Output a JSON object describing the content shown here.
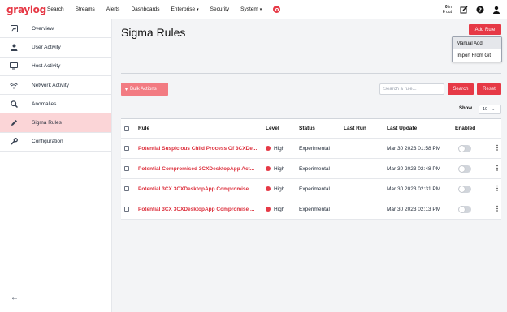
{
  "app": {
    "logo": "graylog"
  },
  "topnav": {
    "items": [
      {
        "label": "Search"
      },
      {
        "label": "Streams"
      },
      {
        "label": "Alerts"
      },
      {
        "label": "Dashboards"
      },
      {
        "label": "Enterprise",
        "caret": "▾"
      },
      {
        "label": "Security"
      },
      {
        "label": "System",
        "caret": "▾"
      }
    ],
    "throughput": {
      "in_value": "0",
      "in_unit": "in",
      "out_value": "0",
      "out_unit": "out"
    }
  },
  "sidebar": {
    "items": [
      {
        "label": "Overview",
        "icon": "overview-icon"
      },
      {
        "label": "User Activity",
        "icon": "user-icon"
      },
      {
        "label": "Host Activity",
        "icon": "monitor-icon"
      },
      {
        "label": "Network Activity",
        "icon": "wifi-icon"
      },
      {
        "label": "Anomalies",
        "icon": "search-icon"
      },
      {
        "label": "Sigma Rules",
        "icon": "pencil-icon",
        "active": true
      },
      {
        "label": "Configuration",
        "icon": "wrench-icon"
      }
    ]
  },
  "page": {
    "title": "Sigma Rules",
    "add_rule_label": "Add Rule",
    "add_menu": [
      "Manual Add",
      "Import From Git"
    ],
    "bulk_actions_label": "Bulk Actions",
    "search_placeholder": "Search a rule...",
    "search_label": "Search",
    "reset_label": "Reset",
    "show_label": "Show",
    "page_size": "10"
  },
  "table": {
    "columns": {
      "rule": "Rule",
      "level": "Level",
      "status": "Status",
      "last_run": "Last Run",
      "last_update": "Last Update",
      "enabled": "Enabled"
    },
    "rows": [
      {
        "rule": "Potential Suspicious Child Process Of 3CXDe...",
        "level": "High",
        "status": "Experimental",
        "last_run": "",
        "last_update": "Mar 30 2023 01:58 PM",
        "enabled": false
      },
      {
        "rule": "Potential Compromised 3CXDesktopApp Act...",
        "level": "High",
        "status": "Experimental",
        "last_run": "",
        "last_update": "Mar 30 2023 02:48 PM",
        "enabled": false
      },
      {
        "rule": "Potential 3CX 3CXDesktopApp Compromise ...",
        "level": "High",
        "status": "Experimental",
        "last_run": "",
        "last_update": "Mar 30 2023 02:31 PM",
        "enabled": false
      },
      {
        "rule": "Potential 3CX 3CXDesktopApp Compromise ...",
        "level": "High",
        "status": "Experimental",
        "last_run": "",
        "last_update": "Mar 30 2023 02:13 PM",
        "enabled": false
      }
    ]
  },
  "colors": {
    "accent": "#e63946",
    "active_bg": "#fbd5d7",
    "link": "#dc2f3c"
  }
}
